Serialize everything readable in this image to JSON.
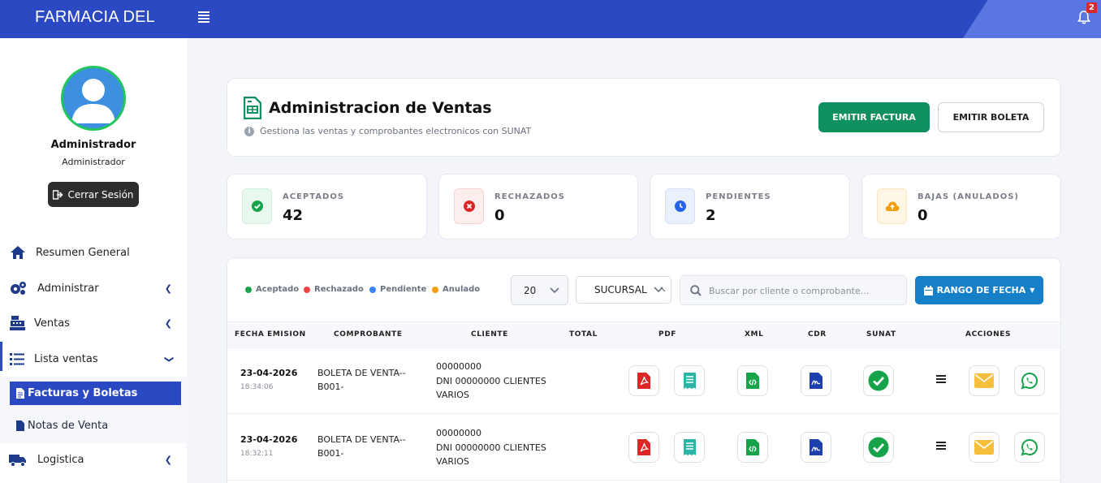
{
  "header": {
    "brand": "FARMACIA DEL",
    "notifications_count": "2"
  },
  "profile": {
    "name": "Administrador",
    "role": "Administrador",
    "logout_label": "Cerrar Sesión"
  },
  "nav": {
    "items": [
      {
        "label": "Resumen General"
      },
      {
        "label": "Administrar"
      },
      {
        "label": "Ventas"
      },
      {
        "label": "Lista ventas"
      },
      {
        "label": "Logistica"
      }
    ],
    "subitems": [
      {
        "label": "Facturas y Boletas"
      },
      {
        "label": "Notas de Venta"
      }
    ]
  },
  "page": {
    "title": "Administracion de Ventas",
    "subtitle": "Gestiona las ventas y comprobantes electronicos con SUNAT",
    "btn_factura": "EMITIR FACTURA",
    "btn_boleta": "EMITIR BOLETA"
  },
  "stats": [
    {
      "label": "ACEPTADOS",
      "value": "42",
      "color": "#16a34a"
    },
    {
      "label": "RECHAZADOS",
      "value": "0",
      "color": "#dc2626"
    },
    {
      "label": "PENDIENTES",
      "value": "2",
      "color": "#2563eb"
    },
    {
      "label": "BAJAS (ANULADOS)",
      "value": "0",
      "color": "#f59e0b"
    }
  ],
  "legend": [
    {
      "label": "Aceptado",
      "color": "#16a34a"
    },
    {
      "label": "Rechazado",
      "color": "#ef4444"
    },
    {
      "label": "Pendiente",
      "color": "#3b82f6"
    },
    {
      "label": "Anulado",
      "color": "#f59e0b"
    }
  ],
  "filters": {
    "page_size": "20",
    "sucursal": "SUCURSAL",
    "search_placeholder": "Buscar por cliente o comprobante...",
    "date_range_label": "RANGO DE FECHA"
  },
  "table": {
    "columns": [
      "FECHA EMISION",
      "COMPROBANTE",
      "CLIENTE",
      "TOTAL",
      "PDF",
      "XML",
      "CDR",
      "SUNAT",
      "ACCIONES"
    ],
    "rows": [
      {
        "date": "23-04-2026",
        "time": "18:34:06",
        "comp_line1": "BOLETA DE VENTA--",
        "comp_line2": "B001-",
        "client_line1": "00000000",
        "client_line2": "DNI 00000000 CLIENTES",
        "client_line3": "VARIOS",
        "total": ""
      },
      {
        "date": "23-04-2026",
        "time": "18:32:11",
        "comp_line1": "BOLETA DE VENTA--",
        "comp_line2": "B001-",
        "client_line1": "00000000",
        "client_line2": "DNI 00000000 CLIENTES",
        "client_line3": "VARIOS",
        "total": ""
      }
    ]
  },
  "colors": {
    "primary": "#2c49c4",
    "success": "#10905f",
    "info": "#1580c8"
  }
}
